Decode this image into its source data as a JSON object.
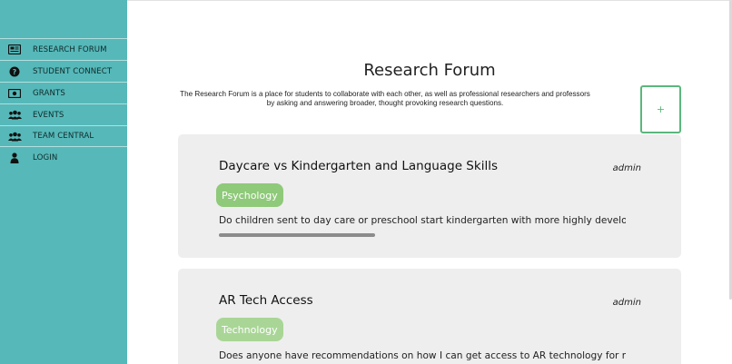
{
  "sidebar": {
    "background_color": "#56b8b9",
    "items": [
      {
        "label": "RESEARCH FORUM",
        "icon": "newspaper-icon"
      },
      {
        "label": "STUDENT CONNECT",
        "icon": "question-circle-icon"
      },
      {
        "label": "GRANTS",
        "icon": "money-bill-icon"
      },
      {
        "label": "EVENTS",
        "icon": "users-icon"
      },
      {
        "label": "TEAM CENTRAL",
        "icon": "users-icon"
      },
      {
        "label": "LOGIN",
        "icon": "user-icon"
      }
    ]
  },
  "header": {
    "title": "Research Forum",
    "description_line1": "The Research Forum is a place for students to collaborate with each other, as well as professional researchers and professors",
    "description_line2": "by asking and answering broader, thought provoking research questions.",
    "add_button_label": "+",
    "add_button_color": "#5ab77c"
  },
  "posts": [
    {
      "title": "Daycare vs Kindergarten and Language Skills",
      "author": "admin",
      "tag": "Psychology",
      "tag_color": "#8fc97a",
      "body": "Do children sent to day care or preschool start kindergarten with more highly developed la"
    },
    {
      "title": "AR Tech Access",
      "author": "admin",
      "tag": "Technology",
      "tag_color": "#a9d696",
      "body": "Does anyone have recommendations on how I can get access to AR technology for resea"
    }
  ]
}
